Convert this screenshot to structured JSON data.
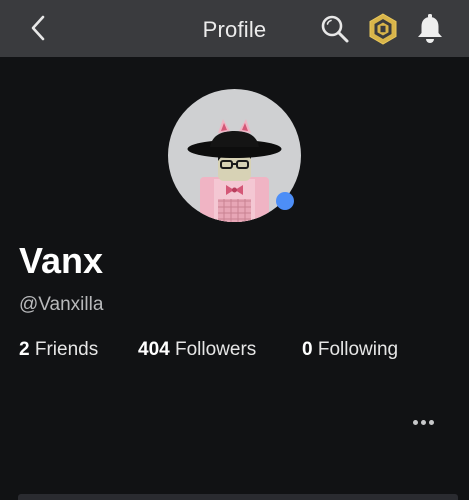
{
  "header": {
    "title": "Profile",
    "back_icon": "chevron-left-icon",
    "search_icon": "search-icon",
    "robux_icon": "robux-icon",
    "notifications_icon": "bell-icon"
  },
  "profile": {
    "display_name": "Vanx",
    "username": "@Vanxilla",
    "presence_color": "#4d8ef7",
    "avatar_icon": "avatar-headshot"
  },
  "stats": {
    "friends": {
      "count": "2",
      "label": "Friends"
    },
    "followers": {
      "count": "404",
      "label": "Followers"
    },
    "following": {
      "count": "0",
      "label": "Following"
    }
  },
  "actions": {
    "more_icon": "more-horizontal-icon"
  },
  "colors": {
    "background": "#111214",
    "topbar": "#3a3b3e",
    "robux_gold": "#d9b54a"
  }
}
